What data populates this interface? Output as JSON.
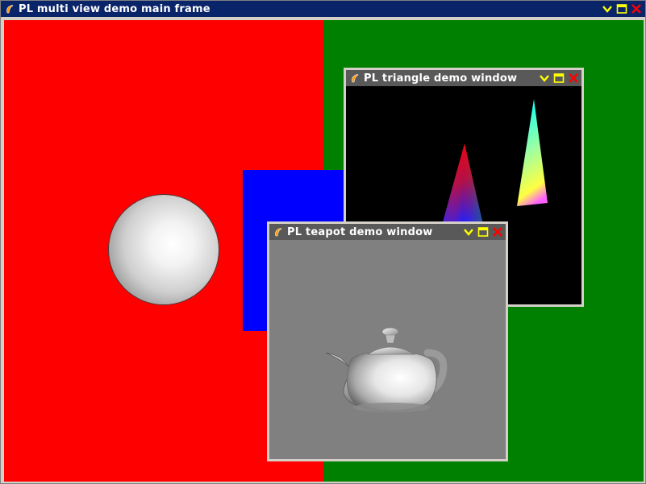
{
  "main_window": {
    "title": "PL multi view demo main frame",
    "buttons": [
      "minimize",
      "maximize",
      "close"
    ]
  },
  "triangle_window": {
    "title": "PL triangle demo window",
    "buttons": [
      "minimize",
      "maximize",
      "close"
    ]
  },
  "teapot_window": {
    "title": "PL teapot demo window",
    "buttons": [
      "minimize",
      "maximize",
      "close"
    ]
  },
  "colors": {
    "main_titlebar": "#0a246a",
    "child_titlebar": "#595959",
    "left_view": "#ff0000",
    "right_view": "#008000",
    "quad": "#0000ff",
    "triangle_view_bg": "#000000",
    "teapot_view_bg": "#808080",
    "button_icon": "#ffff00",
    "close_icon": "#ff0000"
  },
  "icons": {
    "app": "pl-app-icon",
    "minimize": "chevron-down-icon",
    "maximize": "maximize-icon",
    "close": "close-icon"
  }
}
